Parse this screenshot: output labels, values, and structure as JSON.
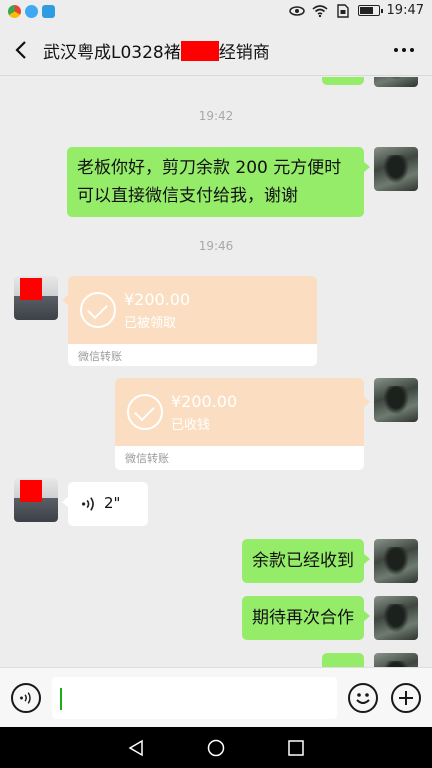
{
  "status_bar": {
    "time": "19:47",
    "app_icons": [
      "chrome-icon",
      "qq-browser-icon",
      "security-icon"
    ],
    "system_icons": [
      "eye-icon",
      "wifi-icon",
      "sim-icon",
      "battery-icon"
    ],
    "battery_level": 0.75
  },
  "header": {
    "title_prefix": "武汉粤成L0328褚",
    "title_suffix": "经销商"
  },
  "messages": {
    "m0_time": "19:42",
    "m1_text_line1": "老板你好，剪刀余款 200 元方便时",
    "m1_text_line2": "可以直接微信支付给我，谢谢",
    "m2_time": "19:46",
    "m3_amount": "¥200.00",
    "m3_status": "已被领取",
    "m3_footer": "微信转账",
    "m4_amount": "¥200.00",
    "m4_status": "已收钱",
    "m4_footer": "微信转账",
    "m5_voice_duration": "2\"",
    "m6_text": "余款已经收到",
    "m7_text": "期待再次合作"
  },
  "colors": {
    "sent_bubble": "#95ec69",
    "transfer_bg": "#fbdec2",
    "redaction": "#ff0000"
  }
}
